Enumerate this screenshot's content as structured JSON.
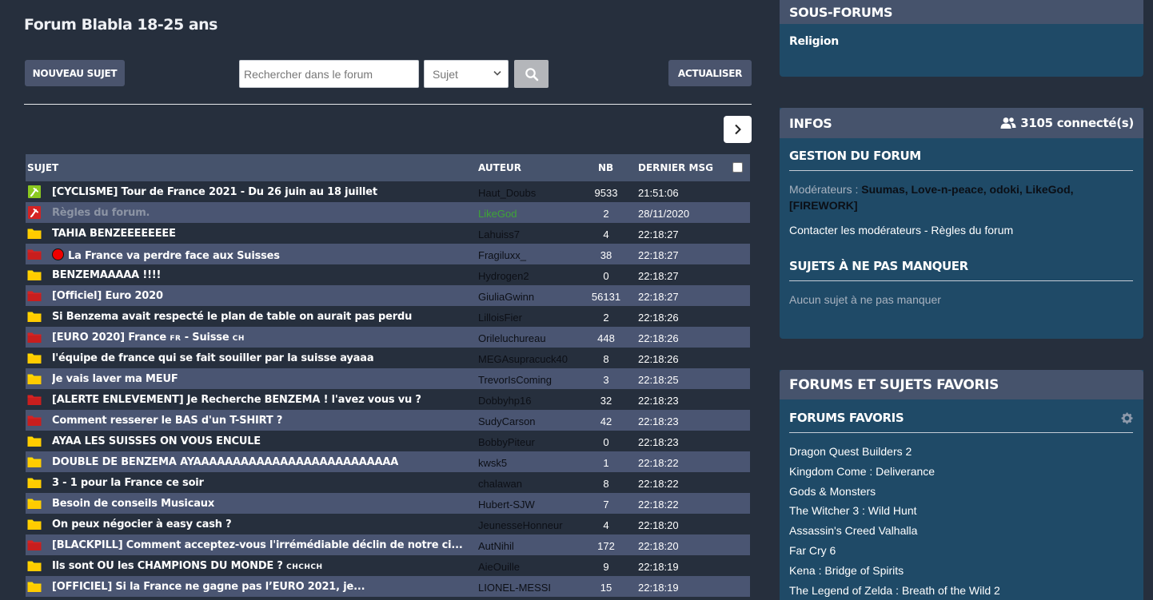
{
  "header": {
    "forum_title": "Forum Blabla 18-25 ans",
    "new_topic": "NOUVEAU SUJET",
    "refresh": "ACTUALISER",
    "search_placeholder": "Rechercher dans le forum",
    "search_scope": "Sujet"
  },
  "table": {
    "col_subject": "SUJET",
    "col_author": "AUTEUR",
    "col_nb": "NB",
    "col_last": "DERNIER MSG",
    "rows": [
      {
        "icon": "pin-green",
        "subject": "[CYCLISME] Tour de France 2021 - Du 26 juin au 18 juillet",
        "author": "Haut_Doubs",
        "nb": "9533",
        "last": "21:51:06"
      },
      {
        "icon": "pin-red",
        "subject": "Règles du forum.",
        "author": "LikeGod",
        "nb": "2",
        "last": "28/11/2020"
      },
      {
        "icon": "folder-yellow",
        "subject": "TAHIA BENZEEEEEEEE",
        "author": "Lahuiss7",
        "nb": "4",
        "last": "22:18:27"
      },
      {
        "icon": "folder-red",
        "subject": "La France va perdre face aux Suisses",
        "author": "Fragiluxx_",
        "nb": "38",
        "last": "22:18:27"
      },
      {
        "icon": "folder-yellow",
        "subject": "BENZEMAAAAA !!!!",
        "author": "Hydrogen2",
        "nb": "0",
        "last": "22:18:27"
      },
      {
        "icon": "folder-red",
        "subject": "[Officiel] Euro 2020",
        "author": "GiuliaGwinn",
        "nb": "56131",
        "last": "22:18:27"
      },
      {
        "icon": "folder-yellow",
        "subject": "Si Benzema avait respecté le plan de table on aurait pas perdu",
        "author": "LilloisFier",
        "nb": "2",
        "last": "22:18:26"
      },
      {
        "icon": "folder-red",
        "subject": "[EURO 2020] France",
        "subject_tag1": "FR",
        "subject_mid": " - Suisse",
        "subject_tag2": "CH",
        "author": "Orileluchureau",
        "nb": "448",
        "last": "22:18:26"
      },
      {
        "icon": "folder-yellow",
        "subject": "l'équipe de france qui se fait souiller par la suisse ayaaa",
        "author": "MEGAsupracuck40",
        "nb": "8",
        "last": "22:18:26"
      },
      {
        "icon": "folder-yellow",
        "subject": "Je vais laver ma MEUF",
        "author": "TrevorIsComing",
        "nb": "3",
        "last": "22:18:25"
      },
      {
        "icon": "folder-red",
        "subject": "[ALERTE ENLEVEMENT] Je Recherche BENZEMA ! l'avez vous vu ?",
        "author": "Dobbyhp16",
        "nb": "32",
        "last": "22:18:23"
      },
      {
        "icon": "folder-red",
        "subject": "Comment resserer le BAS d'un T-SHIRT ?",
        "author": "SudyCarson",
        "nb": "42",
        "last": "22:18:23"
      },
      {
        "icon": "folder-yellow",
        "subject": "AYAA LES SUISSES ON VOUS ENCULE",
        "author": "BobbyPiteur",
        "nb": "0",
        "last": "22:18:23"
      },
      {
        "icon": "folder-yellow",
        "subject": "DOUBLE DE BENZEMA AYAAAAAAAAAAAAAAAAAAAAAAAAAA",
        "author": "kwsk5",
        "nb": "1",
        "last": "22:18:22"
      },
      {
        "icon": "folder-yellow",
        "subject": "3 - 1 pour la France ce soir",
        "author": "chalawan",
        "nb": "8",
        "last": "22:18:22"
      },
      {
        "icon": "folder-yellow",
        "subject": "Besoin de conseils Musicaux",
        "author": "Hubert-SJW",
        "nb": "7",
        "last": "22:18:22"
      },
      {
        "icon": "folder-yellow",
        "subject": "On peux négocier à easy cash ?",
        "author": "JeunesseHonneur",
        "nb": "4",
        "last": "22:18:20"
      },
      {
        "icon": "folder-red",
        "subject": "[BLACKPILL] Comment acceptez-vous l'irrémédiable déclin de notre ci...",
        "author": "AutNihil",
        "nb": "172",
        "last": "22:18:20"
      },
      {
        "icon": "folder-yellow",
        "subject": "Ils sont OÙ les CHAMPIONS DU MONDE ?",
        "subject_tag1": "CHCHCH",
        "author": "AieOuille",
        "nb": "9",
        "last": "22:18:19"
      },
      {
        "icon": "folder-yellow",
        "subject": "[OFFICIEL] Si la France ne gagne pas l’EURO 2021, je...",
        "author": "LIONEL-MESSI",
        "nb": "15",
        "last": "22:18:19"
      }
    ]
  },
  "sidebar": {
    "subforums_title": "SOUS-FORUMS",
    "subforum_1": "Religion",
    "infos_title": "INFOS",
    "connected": "3105 connecté(s)",
    "gestion_title": "GESTION DU FORUM",
    "moderators_label": "Modérateurs : ",
    "moderators": "Suumas, Love-n-peace, odoki, LikeGod, [FIREWORK]",
    "contact_mods": "Contacter les modérateurs",
    "separator": " - ",
    "rules": "Règles du forum",
    "must_see_title": "SUJETS À NE PAS MANQUER",
    "must_see_empty": "Aucun sujet à ne pas manquer",
    "favorites_title": "FORUMS ET SUJETS FAVORIS",
    "fav_forums_title": "FORUMS FAVORIS",
    "fav_forums": [
      "Dragon Quest Builders 2",
      "Kingdom Come : Deliverance",
      "Gods & Monsters",
      "The Witcher 3 : Wild Hunt",
      "Assassin's Creed Valhalla",
      "Far Cry 6",
      "Kena : Bridge of Spirits",
      "The Legend of Zelda : Breath of the Wild 2"
    ]
  },
  "colors": {
    "background": "#262f3d",
    "header_bar": "#46536c",
    "row_alt": "#4a5572",
    "panel": "#1f4a67",
    "folder_yellow": "#ffd600",
    "folder_red": "#d42323",
    "pin_green": "#8bc920"
  }
}
